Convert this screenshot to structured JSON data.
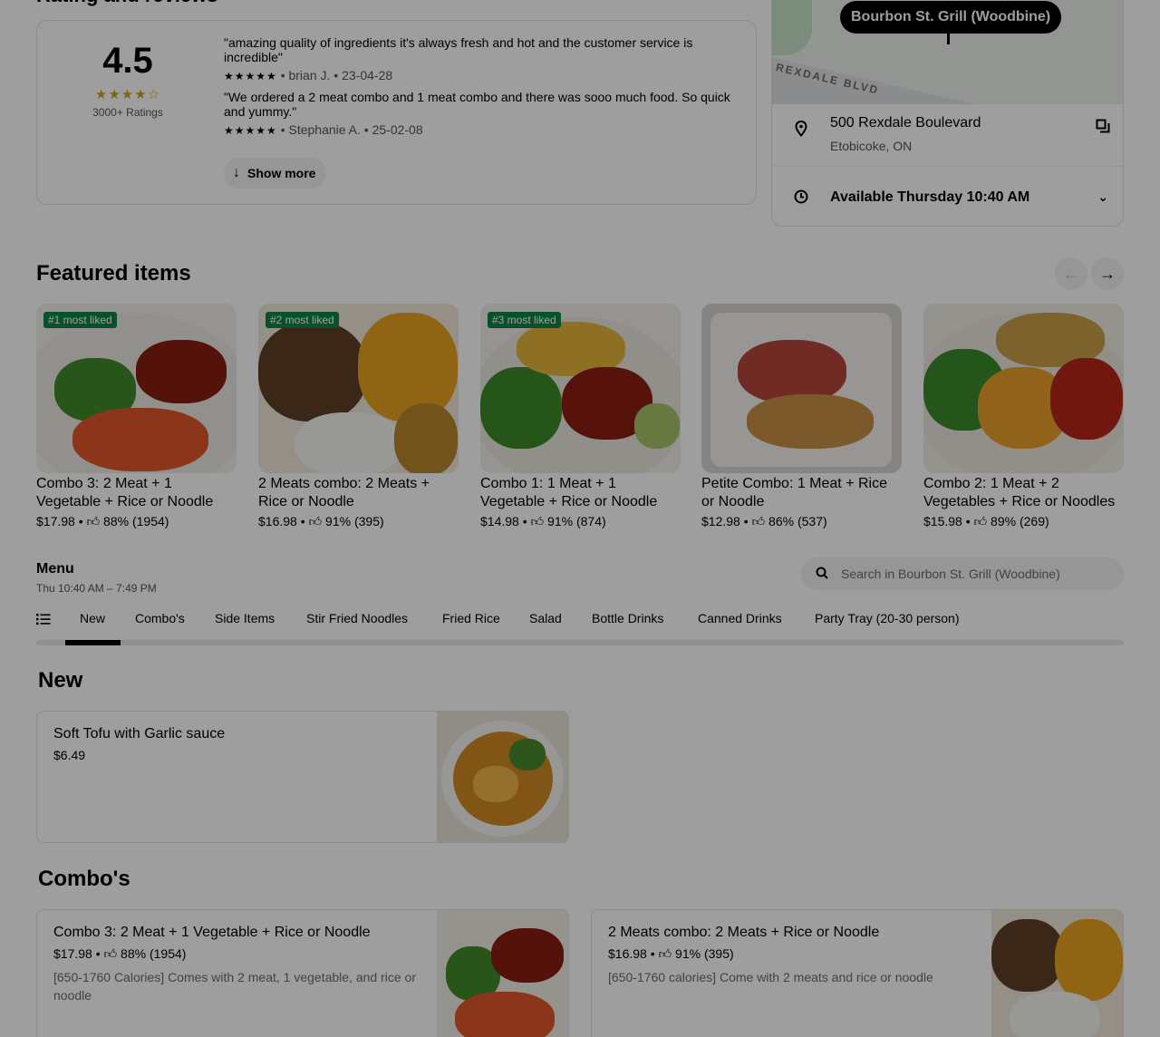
{
  "ratings": {
    "heading": "Rating and reviews",
    "score": "4.5",
    "stars": "★★★★☆",
    "count": "3000+ Ratings",
    "reviews": [
      {
        "text": "\"amazing quality of ingredients it's always fresh and hot and the customer service is incredible\"",
        "stars": "★★★★★",
        "author": "brian J.",
        "date": "23-04-28"
      },
      {
        "text": "\"We ordered a 2 meat combo and 1 meat combo and there was sooo much food. So quick and yummy.\"",
        "stars": "★★★★★",
        "author": "Stephanie A.",
        "date": "25-02-08"
      }
    ],
    "show_more": "Show more"
  },
  "location": {
    "store_name": "Bourbon St. Grill (Woodbine)",
    "road_label": "REXDALE BLVD",
    "address_line1": "500 Rexdale Boulevard",
    "address_line2": "Etobicoke, ON",
    "availability": "Available Thursday 10:40 AM"
  },
  "featured": {
    "heading": "Featured items",
    "items": [
      {
        "badge": "#1 most liked",
        "name": "Combo 3: 2 Meat + 1 Vegetable + Rice or Noodle",
        "price": "$17.98",
        "rating": "88% (1954)"
      },
      {
        "badge": "#2 most liked",
        "name": "2 Meats combo: 2 Meats + Rice or Noodle",
        "price": "$16.98",
        "rating": "91% (395)"
      },
      {
        "badge": "#3 most liked",
        "name": "Combo 1: 1 Meat + 1 Vegetable + Rice or Noodle",
        "price": "$14.98",
        "rating": "91% (874)"
      },
      {
        "badge": "",
        "name": "Petite Combo: 1 Meat + Rice or Noodle",
        "price": "$12.98",
        "rating": "86% (537)"
      },
      {
        "badge": "",
        "name": "Combo 2: 1 Meat + 2 Vegetables + Rice or Noodles",
        "price": "$15.98",
        "rating": "89% (269)"
      }
    ]
  },
  "menu": {
    "title": "Menu",
    "hours": "Thu 10:40 AM – 7:49 PM",
    "search_placeholder": "Search in Bourbon St. Grill (Woodbine)",
    "tabs": [
      "New",
      "Combo's",
      "Side Items",
      "Stir Fried Noodles",
      "Fried Rice",
      "Salad",
      "Bottle Drinks",
      "Canned Drinks",
      "Party Tray (20-30 person)"
    ],
    "active_tab": "New"
  },
  "sections": {
    "new": {
      "heading": "New",
      "items": [
        {
          "name": "Soft Tofu with Garlic sauce",
          "price": "$6.49"
        }
      ]
    },
    "combos": {
      "heading": "Combo's",
      "items": [
        {
          "name": "Combo 3: 2 Meat + 1 Vegetable + Rice or Noodle",
          "price": "$17.98",
          "rating": "88% (1954)",
          "description": "[650-1760 Calories] Comes with 2 meat, 1 vegetable, and rice or noodle"
        },
        {
          "name": "2 Meats combo: 2 Meats + Rice or Noodle",
          "price": "$16.98",
          "rating": "91% (395)",
          "description": "[650-1760 calories] Come with 2 meats and rice or noodle"
        }
      ]
    }
  },
  "icons": {
    "pin": "location-pin-icon",
    "clock": "clock-icon",
    "copy": "copy-icon",
    "chevron": "chevron-down-icon",
    "search": "search-icon",
    "list": "list-icon",
    "thumb": "thumbs-up-icon",
    "arrow_down": "arrow-down-icon"
  },
  "colors": {
    "badge_green": "#0e8345",
    "star_gold": "#c9a227",
    "overlay": "rgba(0,0,0,0.38)"
  }
}
